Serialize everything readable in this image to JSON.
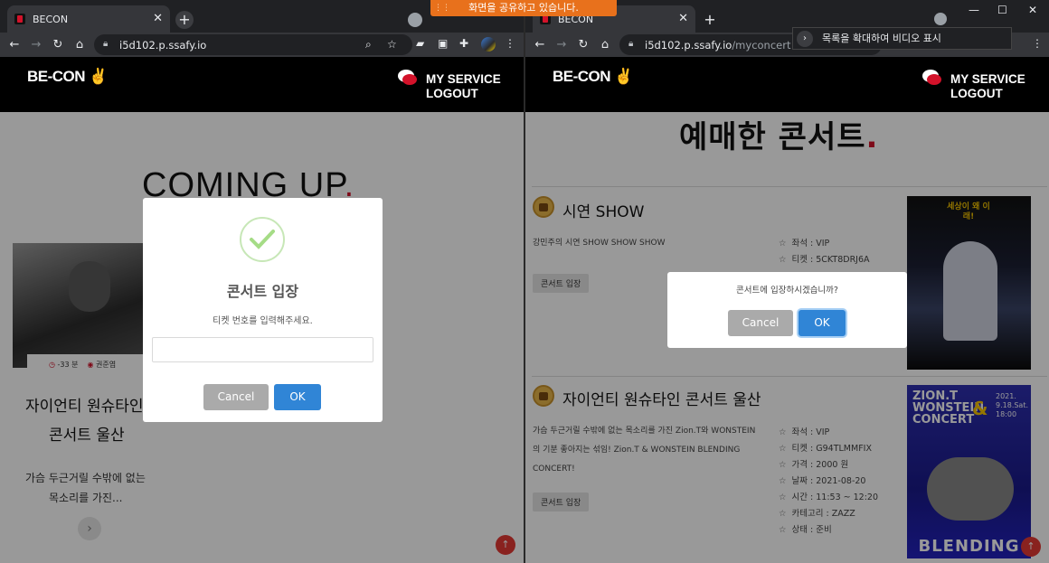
{
  "left": {
    "tab_title": "BECON",
    "url_host": "i5d102.p.ssafy.io",
    "url_path": "",
    "logo": "BE-CON",
    "menu": [
      "MY SERVICE",
      "LOGOUT"
    ],
    "heading": "COMING UP",
    "heading_dot": ".",
    "card": {
      "time": "-33 분",
      "artist": "권준엽",
      "title_line1": "자이언티 원슈타인",
      "title_line2": "콘서트 울산",
      "desc_line1": "가슴 두근거릴 수밖에 없는",
      "desc_line2": "목소리를 가진..."
    },
    "modal": {
      "title": "콘서트 입장",
      "text": "티켓 번호를 입력해주세요.",
      "input_value": "",
      "cancel": "Cancel",
      "ok": "OK"
    }
  },
  "right": {
    "tab_title": "BECON",
    "url_host": "i5d102.p.ssafy.io",
    "url_path": "/myconcert",
    "logo": "BE-CON",
    "menu": [
      "MY SERVICE",
      "LOGOUT"
    ],
    "heading": "예매한 콘서트",
    "heading_dot": ".",
    "concerts": [
      {
        "title": "시연 SHOW",
        "desc": "강민주의 시연 SHOW SHOW SHOW",
        "info": [
          "좌석 : VIP",
          "티켓 : 5CKT8DRJ6A"
        ],
        "enter": "콘서트 입장",
        "poster_text": "세상이 왜 이래!"
      },
      {
        "title": "자이언티 원슈타인 콘서트 울산",
        "desc": "가슴 두근거릴 수밖에 없는 목소리를 가진 Zion.T와 WONSTEIN의 기분 좋아지는 섞임! Zion.T & WONSTEIN BLENDING CONCERT!",
        "info": [
          "좌석 : VIP",
          "티켓 : G94TLMMFIX",
          "가격 : 2000 원",
          "날짜 : 2021-08-20",
          "시간 : 11:53 ~ 12:20",
          "카테고리 : ZAZZ",
          "상태 : 준비"
        ],
        "enter": "콘서트 입장",
        "poster_top": "ZION.T WONSTEIN CONCERT",
        "poster_amp": "&",
        "poster_date": "2021. 9.18.Sat. 18:00",
        "poster_bottom": "BLENDING"
      }
    ],
    "modal": {
      "text": "콘서트에 입장하시겠습니까?",
      "cancel": "Cancel",
      "ok": "OK"
    }
  },
  "share_bar": "화면을 공유하고 있습니다.",
  "tooltip": "목록을 확대하여 비디오 표시",
  "colors": {
    "accent": "#d3122a",
    "ok": "#3085d6",
    "cancel": "#aaaaaa",
    "share": "#e8711c"
  }
}
